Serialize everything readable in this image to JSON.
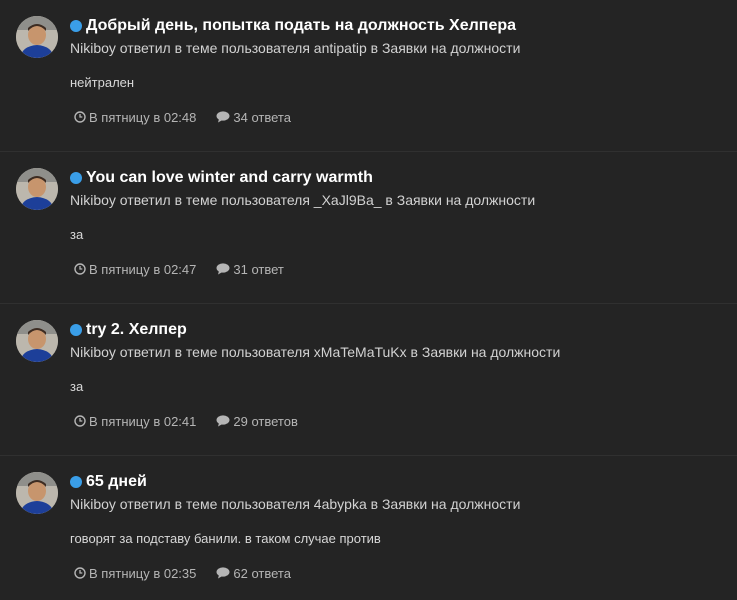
{
  "posts": [
    {
      "title": "Добрый день, попытка подать на должность Хелпера",
      "user": "Nikiboy",
      "action": "ответил в теме пользователя",
      "author": "antipatip",
      "prep": "в",
      "forum": "Заявки на должности",
      "snippet": "нейтрален",
      "time": "В пятницу в 02:48",
      "replies": "34 ответа"
    },
    {
      "title": "You can love winter and carry warmth",
      "user": "Nikiboy",
      "action": "ответил в теме пользователя",
      "author": "_XaJl9Ba_",
      "prep": "в",
      "forum": "Заявки на должности",
      "snippet": "за",
      "time": "В пятницу в 02:47",
      "replies": "31 ответ"
    },
    {
      "title": "try 2. Хелпер",
      "user": "Nikiboy",
      "action": "ответил в теме пользователя",
      "author": "xMaTeMaTuKx",
      "prep": "в",
      "forum": "Заявки на должности",
      "snippet": "за",
      "time": "В пятницу в 02:41",
      "replies": "29 ответов"
    },
    {
      "title": "65 дней",
      "user": "Nikiboy",
      "action": "ответил в теме пользователя",
      "author": "4abypka",
      "prep": "в",
      "forum": "Заявки на должности",
      "snippet": "говорят за подставу банили. в таком случае против",
      "time": "В пятницу в 02:35",
      "replies": "62 ответа"
    }
  ],
  "colors": {
    "background": "#242424",
    "unread_dot": "#3a9ee8",
    "title": "#ffffff",
    "meta": "#b5b5b5"
  },
  "icons": {
    "unread": "unread-dot-icon",
    "time": "clock-icon",
    "replies": "speech-bubble-icon",
    "avatar": "user-avatar"
  }
}
